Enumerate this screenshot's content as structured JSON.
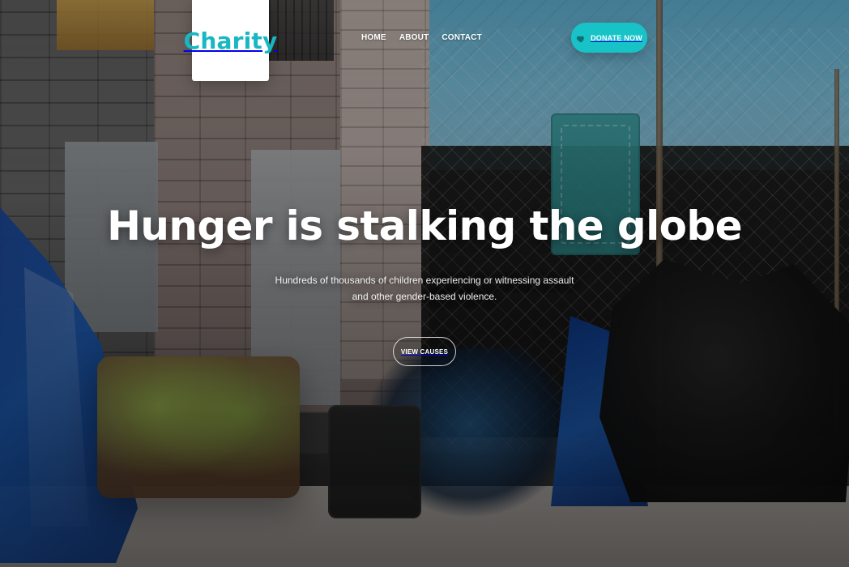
{
  "header": {
    "logo_text": "Charity",
    "nav": [
      {
        "label": "HOME"
      },
      {
        "label": "ABOUT"
      },
      {
        "label": "CONTACT"
      }
    ],
    "cta": {
      "icon": "heart-icon",
      "label": "DONATE NOW"
    }
  },
  "hero": {
    "title": "Hunger is stalking the globe",
    "subtitle_line_1": "Hundreds of thousands of children experiencing or witnessing assault",
    "subtitle_line_2": "and other gender-based violence.",
    "button_label": "VIEW CAUSES"
  },
  "colors": {
    "brand_teal": "#18b7c2",
    "cta_teal": "#18c3c7"
  }
}
